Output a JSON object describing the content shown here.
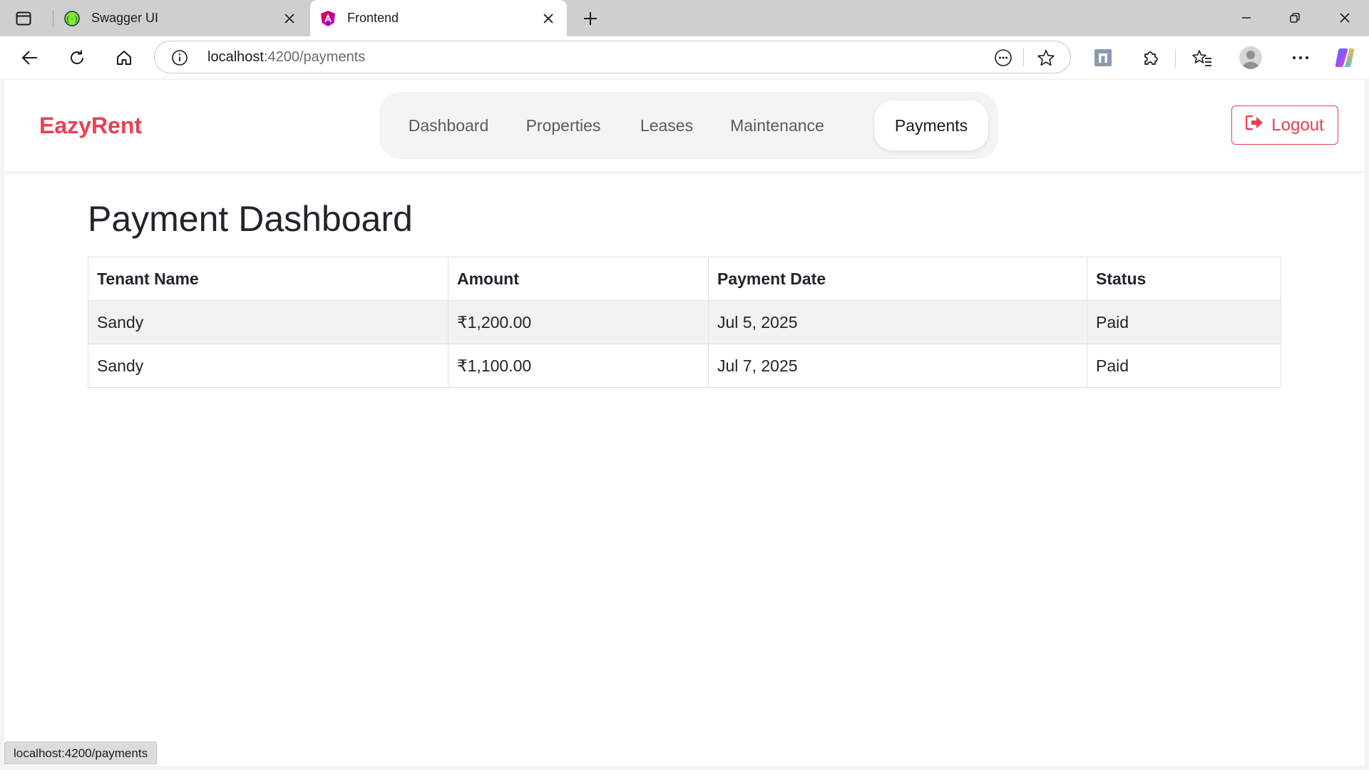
{
  "browser": {
    "tabs": [
      {
        "title": "Swagger UI",
        "favicon": "swagger-icon",
        "active": false
      },
      {
        "title": "Frontend",
        "favicon": "angular-icon",
        "active": true
      }
    ],
    "address": {
      "host": "localhost",
      "path": ":4200/payments"
    },
    "status_url": "localhost:4200/payments"
  },
  "app": {
    "brand": "EazyRent",
    "nav": [
      {
        "label": "Dashboard",
        "active": false
      },
      {
        "label": "Properties",
        "active": false
      },
      {
        "label": "Leases",
        "active": false
      },
      {
        "label": "Maintenance",
        "active": false
      },
      {
        "label": "Payments",
        "active": true
      }
    ],
    "logout_label": "Logout",
    "accent_color": "#e8414f"
  },
  "main": {
    "title": "Payment Dashboard",
    "table": {
      "headers": [
        "Tenant Name",
        "Amount",
        "Payment Date",
        "Status"
      ],
      "rows": [
        [
          "Sandy",
          "₹1,200.00",
          "Jul 5, 2025",
          "Paid"
        ],
        [
          "Sandy",
          "₹1,100.00",
          "Jul 7, 2025",
          "Paid"
        ]
      ]
    }
  }
}
